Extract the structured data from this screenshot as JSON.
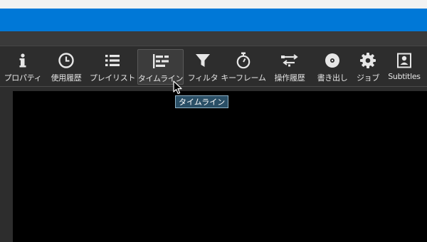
{
  "toolbar": {
    "items": [
      {
        "label": "プロパティ",
        "icon": "info-icon"
      },
      {
        "label": "使用履歴",
        "icon": "clock-icon"
      },
      {
        "label": "プレイリスト",
        "icon": "list-icon"
      },
      {
        "label": "タイムライン",
        "icon": "timeline-icon",
        "active": true
      },
      {
        "label": "フィルタ",
        "icon": "funnel-icon"
      },
      {
        "label": "キーフレーム",
        "icon": "stopwatch-icon"
      },
      {
        "label": "操作履歴",
        "icon": "history-icon"
      },
      {
        "label": "書き出し",
        "icon": "disc-icon"
      },
      {
        "label": "ジョブ",
        "icon": "gear-icon"
      },
      {
        "label": "Subtitles",
        "icon": "subtitles-icon"
      }
    ]
  },
  "tooltip": {
    "text": "タイムライン"
  },
  "colors": {
    "titlebar": "#0078d7",
    "background": "#2d2d2d",
    "preview": "#000000",
    "tooltip_bg": "#2a4f66"
  }
}
